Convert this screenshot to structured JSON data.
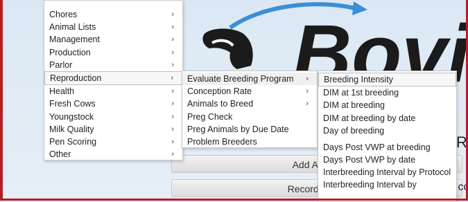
{
  "colors": {
    "frame": "#b51f24",
    "logo_dark": "#1b1b1b",
    "swoosh": "#3a8fd6"
  },
  "logo": {
    "text": "Bovis"
  },
  "background": {
    "add_animal_label": "Add Animal",
    "record_event_label": "Record Event",
    "right_fragment_1": "R",
    "right_fragment_2": ".co"
  },
  "main_menu": {
    "items": [
      {
        "label": "Chores",
        "has_submenu": true
      },
      {
        "label": "Animal Lists",
        "has_submenu": true
      },
      {
        "label": "Management",
        "has_submenu": true
      },
      {
        "label": "Production",
        "has_submenu": true
      },
      {
        "label": "Parlor",
        "has_submenu": true
      },
      {
        "label": "Reproduction",
        "has_submenu": true
      },
      {
        "label": "Health",
        "has_submenu": true
      },
      {
        "label": "Fresh Cows",
        "has_submenu": true
      },
      {
        "label": "Youngstock",
        "has_submenu": true
      },
      {
        "label": "Milk Quality",
        "has_submenu": true
      },
      {
        "label": "Pen Scoring",
        "has_submenu": true
      },
      {
        "label": "Other",
        "has_submenu": true
      }
    ],
    "active": "Reproduction",
    "arrow_glyph": "›"
  },
  "reproduction_menu": {
    "items": [
      {
        "label": "Evaluate Breeding Program",
        "has_submenu": true
      },
      {
        "label": "Conception Rate",
        "has_submenu": true
      },
      {
        "label": "Animals to Breed",
        "has_submenu": true
      },
      {
        "label": "Preg Check",
        "has_submenu": false
      },
      {
        "label": "Preg Animals by Due Date",
        "has_submenu": false
      },
      {
        "label": "Problem Breeders",
        "has_submenu": false
      }
    ],
    "active": "Evaluate Breeding Program"
  },
  "evaluate_menu": {
    "items": [
      {
        "label": "Breeding Intensity"
      },
      {
        "label": "DIM at 1st breeding"
      },
      {
        "label": "DIM at breeding"
      },
      {
        "label": "DIM at breeding by date"
      },
      {
        "label": "Day of breeding"
      },
      {
        "label": "Days Post VWP at breeding"
      },
      {
        "label": "Days Post VWP by date"
      },
      {
        "label": "Interbreeding Interval by Protocol"
      },
      {
        "label": "Interbreeding Interval by"
      }
    ],
    "highlighted": "Breeding Intensity"
  }
}
